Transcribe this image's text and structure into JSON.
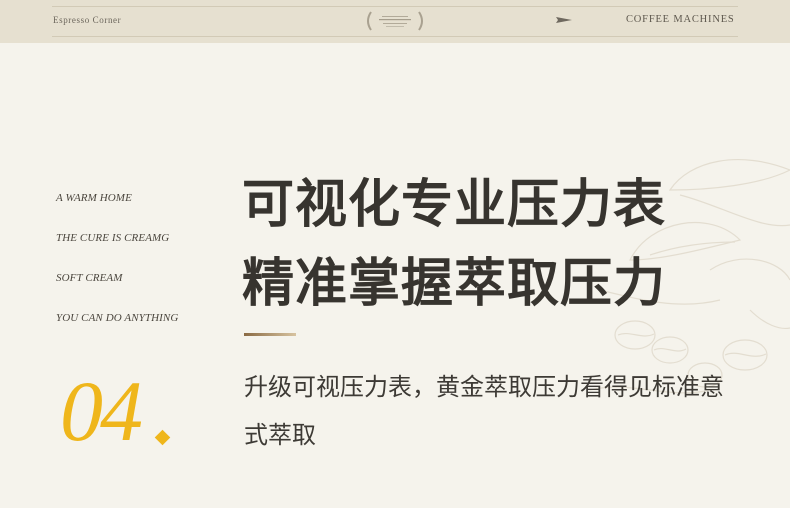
{
  "header": {
    "brand": "Espresso Corner",
    "nav_label": "COFFEE MACHINES"
  },
  "taglines": [
    "A WARM HOME",
    "THE CURE IS CREAMG",
    "SOFT CREAM",
    "YOU CAN DO ANYTHING"
  ],
  "section_number": "04",
  "headline": {
    "line1": "可视化专业压力表",
    "line2": "精准掌握萃取压力"
  },
  "description": "升级可视压力表，黄金萃取压力看得见标准意式萃取",
  "colors": {
    "accent": "#efb61b",
    "background": "#f5f3ec",
    "header_bg": "#e6e0d0",
    "text": "#37342f"
  }
}
